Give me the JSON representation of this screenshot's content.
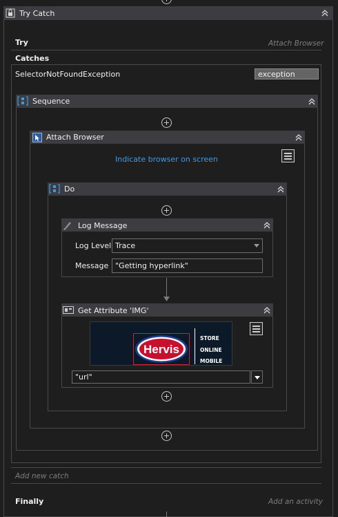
{
  "try_catch": {
    "title": "Try Catch",
    "try_label": "Try",
    "try_hint": "Attach Browser",
    "catches_label": "Catches",
    "exception_type": "SelectorNotFoundException",
    "exception_var": "exception",
    "add_catch": "Add new catch",
    "finally_label": "Finally",
    "finally_hint": "Add an activity"
  },
  "sequence": {
    "title": "Sequence"
  },
  "attach_browser": {
    "title": "Attach Browser",
    "indicate_link": "Indicate browser on screen"
  },
  "do_block": {
    "title": "Do"
  },
  "log_message": {
    "title": "Log Message",
    "level_label": "Log Level",
    "level_value": "Trace",
    "message_label": "Message",
    "message_value": "\"Getting hyperlink\""
  },
  "get_attribute": {
    "title": "Get Attribute 'IMG'",
    "preview": {
      "logo_text": "Hervis",
      "side_lines": [
        "STORE",
        "ONLINE",
        "MOBILE"
      ]
    },
    "attribute_value": "\"url\""
  },
  "colors": {
    "link": "#3f9be6",
    "header": "#3c3c41",
    "background": "#1e1e1e",
    "logo_red": "#c8102e",
    "logo_blue": "#1d3d8f"
  }
}
